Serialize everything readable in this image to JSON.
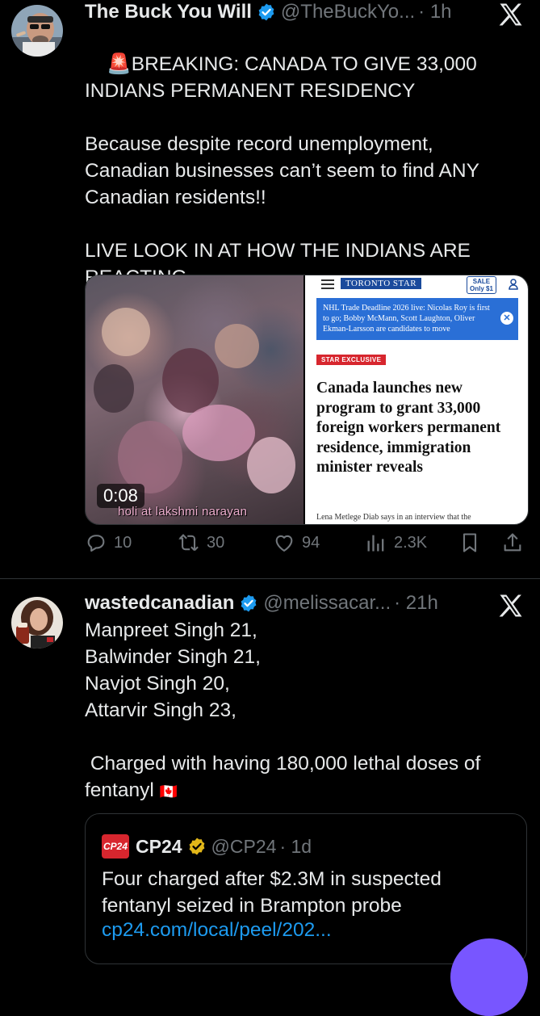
{
  "tweet1": {
    "display_name": "The Buck You Will",
    "handle": "@TheBuckYo...",
    "time": "· 1h",
    "emoji": "🚨",
    "text_line1": "BREAKING: CANADA TO GIVE 33,000",
    "text_rest": "INDIANS PERMANENT RESIDENCY\n\nBecause despite record unemployment,\nCanadian businesses can’t seem to find ANY\nCanadian residents!!\n\nLIVE LOOK IN AT HOW THE INDIANS ARE\nREACTING.",
    "video": {
      "duration": "0:08",
      "caption": "holi at lakshmi narayan"
    },
    "article": {
      "logo": "TORONTO STAR",
      "sale_line1": "SALE",
      "sale_line2": "Only $1",
      "banner": "NHL Trade Deadline 2026 live: Nicolas Roy is first to go; Bobby McMann, Scott Laughton, Oliver Ekman-Larsson are candidates to move",
      "tag": "STAR EXCLUSIVE",
      "headline": "Canada launches new program to grant 33,000 foreign workers permanent residence, immigration minister reveals",
      "subline": "Lena Metlege Diab says in an interview that the"
    },
    "actions": {
      "replies": "10",
      "reposts": "30",
      "likes": "94",
      "views": "2.3K"
    }
  },
  "tweet2": {
    "display_name": "wastedcanadian",
    "handle": "@melissacar...",
    "time": "· 21h",
    "text": "Manpreet Singh 21,\nBalwinder Singh 21,\nNavjot Singh 20,\nAttarvir Singh 23,\n\n Charged with having 180,000 lethal doses of\nfentanyl",
    "flag": "🇨🇦",
    "quote": {
      "logo": "CP24",
      "display_name": "CP24",
      "handle": "@CP24",
      "time": "· 1d",
      "text": "Four charged after $2.3M in suspected fentanyl seized in Brampton probe",
      "link": "cp24.com/local/peel/202..."
    }
  },
  "colors": {
    "background": "#000000",
    "text": "#e7e9ea",
    "muted": "#71767b",
    "verified_blue": "#1d9bf0",
    "verified_gold": "#e2b719",
    "link": "#1d9bf0",
    "fab": "#7856ff"
  }
}
